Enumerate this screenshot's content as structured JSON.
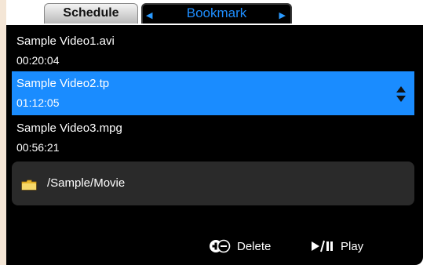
{
  "tabs": {
    "schedule": "Schedule",
    "bookmark": "Bookmark",
    "left_arrow": "◀",
    "right_arrow": "▶"
  },
  "items": [
    {
      "name": "Sample Video1.avi",
      "time": "00:20:04",
      "selected": false
    },
    {
      "name": "Sample Video2.tp",
      "time": "01:12:05",
      "selected": true
    },
    {
      "name": "Sample Video3.mpg",
      "time": "00:56:21",
      "selected": false
    }
  ],
  "path": "/Sample/Movie",
  "actions": {
    "delete": "Delete",
    "play": "Play"
  },
  "colors": {
    "accent": "#1a8cff",
    "tab_text": "#1e8eff",
    "background": "#000000"
  },
  "icons": {
    "folder": "folder-icon",
    "delete": "add-remove-icon",
    "play": "play-pause-icon",
    "scroll": "scroll-up-down-icon"
  }
}
